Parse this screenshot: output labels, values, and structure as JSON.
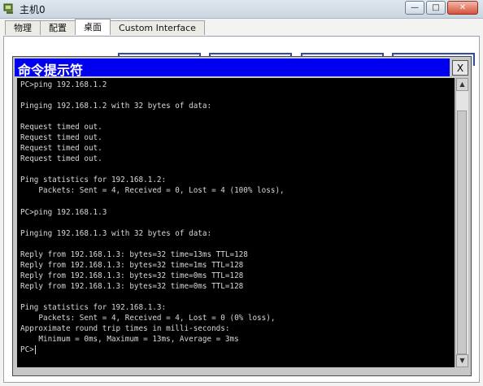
{
  "window": {
    "title": "主机0",
    "icon": "pc-icon",
    "minimize_icon": "minimize-icon",
    "maximize_icon": "maximize-icon",
    "close_icon": "close-icon"
  },
  "tabs": [
    {
      "label": "物理",
      "active": false
    },
    {
      "label": "配置",
      "active": false
    },
    {
      "label": "桌面",
      "active": true
    },
    {
      "label": "Custom Interface",
      "active": false
    }
  ],
  "cmd_window": {
    "title": "命令提示符",
    "close_label": "X",
    "lines": [
      "PC>ping 192.168.1.2",
      "",
      "Pinging 192.168.1.2 with 32 bytes of data:",
      "",
      "Request timed out.",
      "Request timed out.",
      "Request timed out.",
      "Request timed out.",
      "",
      "Ping statistics for 192.168.1.2:",
      "    Packets: Sent = 4, Received = 0, Lost = 4 (100% loss),",
      "",
      "PC>ping 192.168.1.3",
      "",
      "Pinging 192.168.1.3 with 32 bytes of data:",
      "",
      "Reply from 192.168.1.3: bytes=32 time=13ms TTL=128",
      "Reply from 192.168.1.3: bytes=32 time=1ms TTL=128",
      "Reply from 192.168.1.3: bytes=32 time=0ms TTL=128",
      "Reply from 192.168.1.3: bytes=32 time=0ms TTL=128",
      "",
      "Ping statistics for 192.168.1.3:",
      "    Packets: Sent = 4, Received = 4, Lost = 0 (0% loss),",
      "Approximate round trip times in milli-seconds:",
      "    Minimum = 0ms, Maximum = 13ms, Average = 3ms",
      ""
    ],
    "prompt": "PC>"
  },
  "colors": {
    "cmd_titlebar": "#0000ee",
    "terminal_bg": "#000000",
    "terminal_text": "#d8d8d8"
  }
}
